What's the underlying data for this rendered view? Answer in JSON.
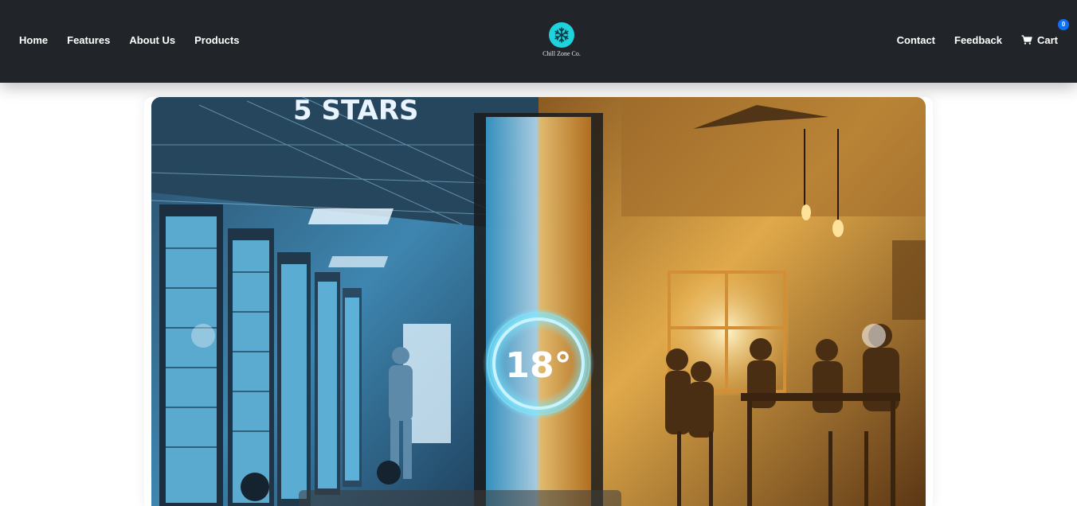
{
  "nav": {
    "left": [
      {
        "label": "Home"
      },
      {
        "label": "Features"
      },
      {
        "label": "About Us"
      },
      {
        "label": "Products"
      }
    ],
    "right": [
      {
        "label": "Contact"
      },
      {
        "label": "Feedback"
      }
    ],
    "cart": {
      "label": "Cart",
      "count": "0",
      "icon": "cart-icon"
    }
  },
  "brand": {
    "name": "Chill Zone Co.",
    "icon": "snowflake-icon",
    "logo_color": "#1fd3dc"
  },
  "hero": {
    "rating_text": "5 STARS",
    "temperature_text": "18°"
  },
  "colors": {
    "navbar": "#212529",
    "badge": "#0d6efd"
  }
}
